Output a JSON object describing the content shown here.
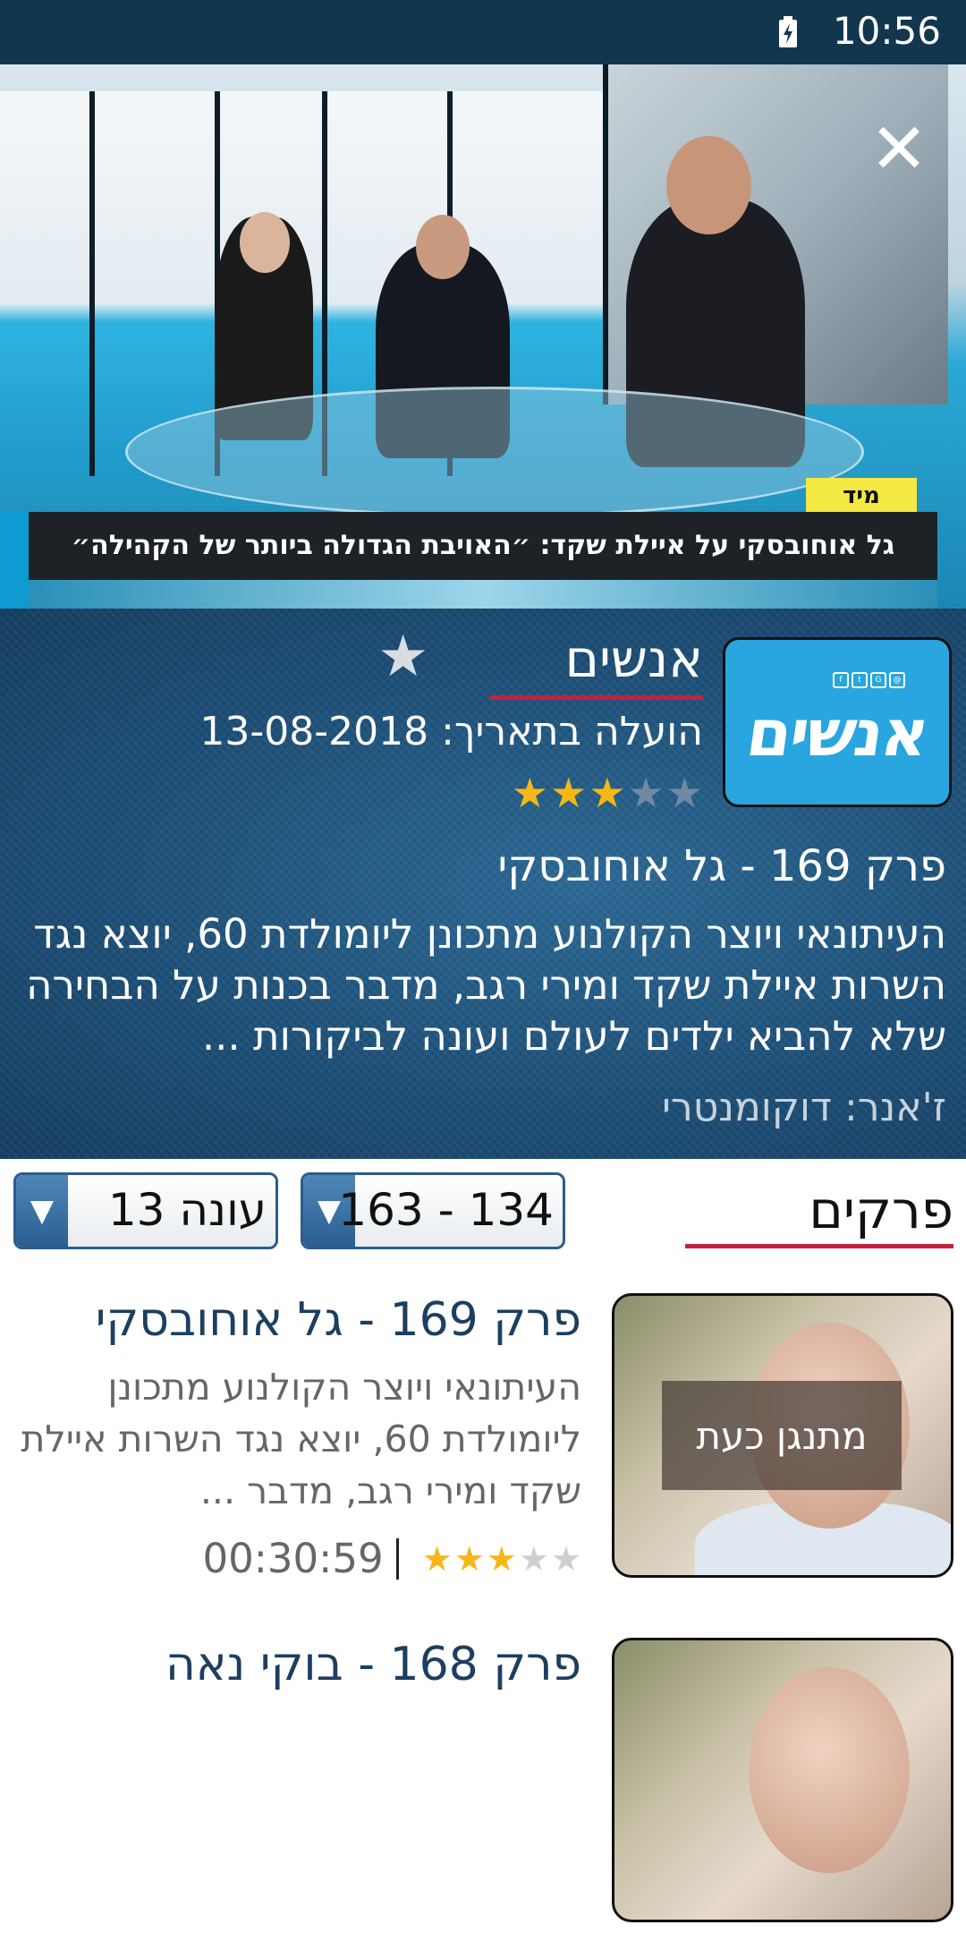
{
  "status_bar": {
    "time": "10:56",
    "battery_icon": "battery-charging-icon"
  },
  "video": {
    "tag": "מיד",
    "ticker": "גל אוחובסקי על איילת שקד: ״האויבת הגדולה ביותר של הקהילה״",
    "close_icon": "close-icon"
  },
  "show": {
    "title": "אנשים",
    "logo_text": "אנשים",
    "upload_date": "הועלה בתאריך: 13-08-2018",
    "rating": 3,
    "rating_max": 5,
    "episode_heading": "פרק 169 - גל אוחובסקי",
    "description": "העיתונאי ויוצר הקולנוע מתכונן ליומולדת 60, יוצא נגד השרות איילת שקד ומירי רגב, מדבר בכנות על הבחירה שלא להביא ילדים לעולם ועונה לביקורות ...",
    "genre": "ז'אנר: דוקומנטרי"
  },
  "episodes_section": {
    "title": "פרקים",
    "range_dropdown": "134 - 163",
    "season_dropdown": "עונה 13"
  },
  "episodes": [
    {
      "title": "פרק 169 - גל אוחובסקי",
      "description": "העיתונאי ויוצר הקולנוע מתכונן ליומולדת 60, יוצא נגד השרות איילת שקד ומירי רגב, מדבר ...",
      "duration": "00:30:59",
      "rating": 3,
      "badge": "מתנגן כעת"
    },
    {
      "title": "פרק 168 - בוקי נאה"
    }
  ],
  "colors": {
    "status_bar": "#13364f",
    "accent_underline": "#c8213f",
    "star_active": "#f5b818",
    "dropdown_border": "#2e5c8a",
    "episode_title": "#1d3e60"
  }
}
